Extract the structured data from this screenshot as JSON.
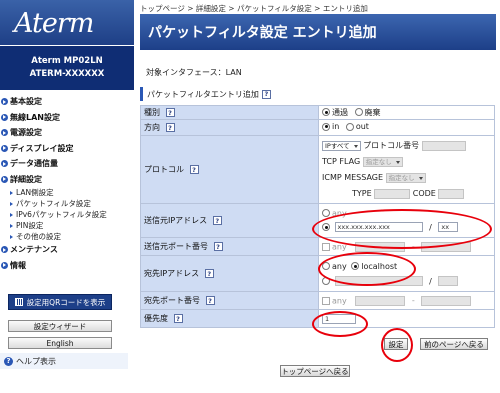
{
  "brand": {
    "logo": "Aterm",
    "model_line1": "Aterm   MP02LN",
    "model_line2": "ATERM-XXXXXX"
  },
  "sidebar": {
    "items": [
      {
        "label": "基本設定",
        "level": "top"
      },
      {
        "label": "無線LAN設定",
        "level": "top"
      },
      {
        "label": "電源設定",
        "level": "top"
      },
      {
        "label": "ディスプレイ設定",
        "level": "top"
      },
      {
        "label": "データ通信量",
        "level": "top"
      },
      {
        "label": "詳細設定",
        "level": "top"
      },
      {
        "label": "LAN側設定",
        "level": "sub"
      },
      {
        "label": "パケットフィルタ設定",
        "level": "sub"
      },
      {
        "label": "IPv6パケットフィルタ設定",
        "level": "sub"
      },
      {
        "label": "PIN設定",
        "level": "sub"
      },
      {
        "label": "その他の設定",
        "level": "sub"
      },
      {
        "label": "メンテナンス",
        "level": "top"
      },
      {
        "label": "情報",
        "level": "top"
      }
    ],
    "qr_button": "設定用QRコードを表示",
    "wizard_button": "設定ウィザード",
    "english_button": "English",
    "help_label": "ヘルプ表示"
  },
  "breadcrumb": "トップページ > 詳細設定 > パケットフィルタ設定 > エントリ追加",
  "page_title": "パケットフィルタ設定 エントリ追加",
  "interface_line": "対象インタフェース：LAN",
  "section_title": "パケットフィルタエントリ追加",
  "form": {
    "type_label": "種別",
    "type_options": [
      "通過",
      "廃棄"
    ],
    "direction_label": "方向",
    "direction_options": [
      "in",
      "out"
    ],
    "protocol_label": "プロトコル",
    "protocol_select": "IPすべて",
    "protocol_number_label": "プロトコル番号",
    "tcp_flag_label": "TCP FLAG",
    "tcp_flag_value": "指定なし",
    "icmp_message_label": "ICMP MESSAGE",
    "icmp_message_value": "指定なし",
    "icmp_type_label": "TYPE",
    "icmp_code_label": "CODE",
    "src_ip_label": "送信元IPアドレス",
    "src_ip_option_top": "any",
    "src_ip_value": "xxx.xxx.xxx.xxx",
    "src_ip_mask": "xx",
    "src_port_label": "送信元ポート番号",
    "src_port_any": "any",
    "dst_ip_label": "宛先IPアドレス",
    "dst_ip_option_any": "any",
    "dst_ip_option_localhost": "localhost",
    "dst_port_label": "宛先ポート番号",
    "dst_port_any": "any",
    "priority_label": "優先度",
    "priority_value": "1",
    "slash": "/",
    "dash": "-",
    "help_glyph": "?"
  },
  "buttons": {
    "apply": "設定",
    "back": "前のページへ戻る",
    "top": "トップページへ戻る"
  },
  "colors": {
    "title_bar": "#1d3f88",
    "label_cell": "#cfdcf3",
    "annotation_ring": "#e8000b"
  }
}
